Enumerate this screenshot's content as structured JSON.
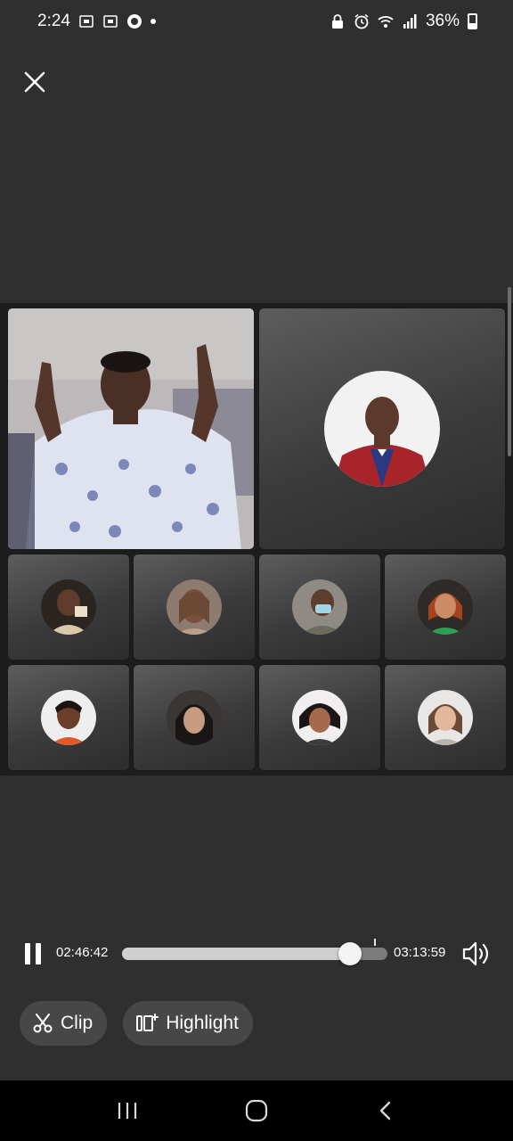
{
  "status_bar": {
    "time": "2:24",
    "battery": "36%",
    "battery_level": 0.36,
    "left_icons": [
      "screen-record-icon",
      "screen-record-icon",
      "app-notification-icon",
      "dot-icon"
    ],
    "right_icons": [
      "lock-icon",
      "alarm-icon",
      "wifi-icon",
      "signal-icon",
      "battery-icon"
    ]
  },
  "colors": {
    "background": "#2f2f30",
    "tile": "#4a4a4b",
    "button": "#474747",
    "nav_bar": "#000000",
    "text": "#ffffff"
  },
  "participants": {
    "main_video": {
      "kind": "live-video",
      "icon": "participant-video"
    },
    "featured_avatar": {
      "kind": "avatar",
      "icon": "participant-avatar"
    },
    "grid_count": 8
  },
  "player": {
    "current_time": "02:46:42",
    "total_time": "03:13:59",
    "progress": 0.86,
    "paused_icon": "pause-icon",
    "volume_icon": "volume-icon"
  },
  "actions": {
    "clip_label": "Clip",
    "highlight_label": "Highlight",
    "clip_icon": "scissors-icon",
    "highlight_icon": "highlight-icon"
  },
  "nav": {
    "recents_icon": "recents-icon",
    "home_icon": "home-icon",
    "back_icon": "back-icon"
  }
}
